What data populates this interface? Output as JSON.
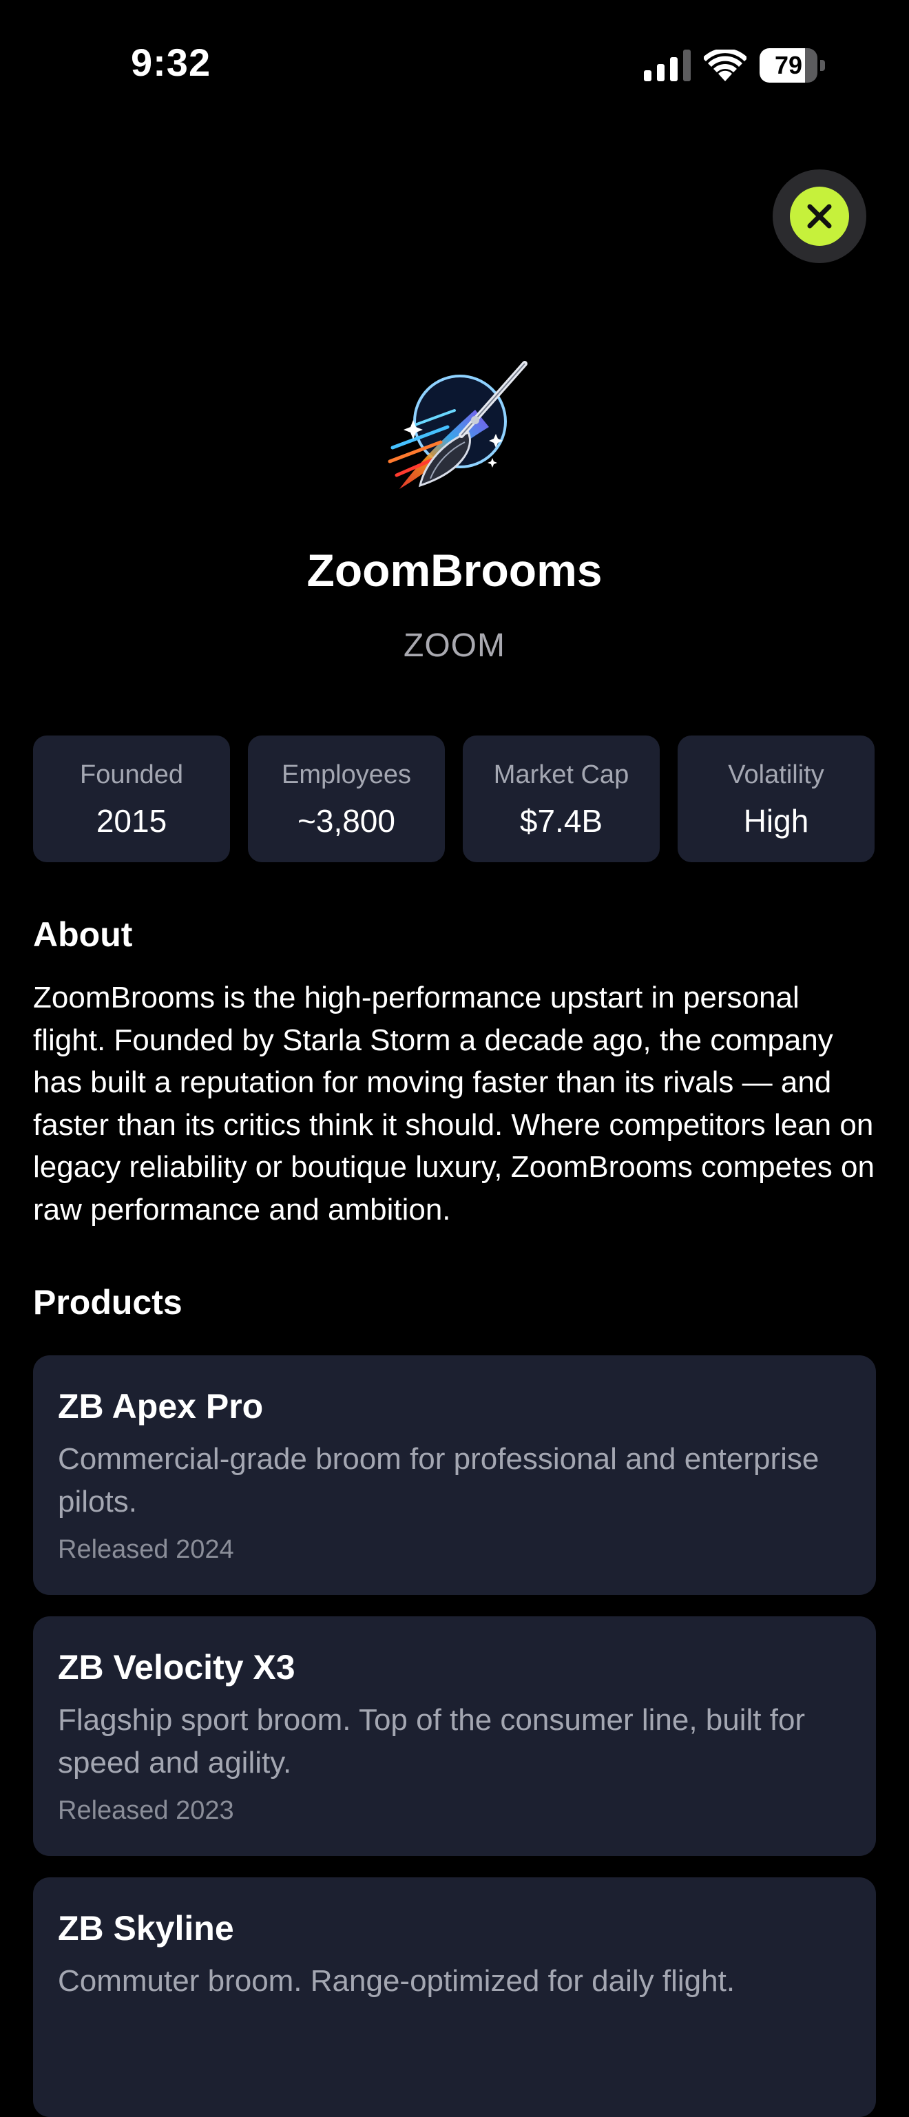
{
  "status_bar": {
    "time": "9:32",
    "battery_level": "79",
    "battery_fraction": 0.79,
    "signal_icon": "cellular-signal-icon",
    "wifi_icon": "wifi-icon"
  },
  "close_button": {
    "icon": "close-icon",
    "accent_color": "#c6f13b"
  },
  "company": {
    "logo": "broom-rocket-logo",
    "name": "ZoomBrooms",
    "ticker": "ZOOM"
  },
  "stats": [
    {
      "label": "Founded",
      "value": "2015"
    },
    {
      "label": "Employees",
      "value": "~3,800"
    },
    {
      "label": "Market Cap",
      "value": "$7.4B"
    },
    {
      "label": "Volatility",
      "value": "High"
    }
  ],
  "about": {
    "heading": "About",
    "text": "ZoomBrooms is the high-performance upstart in personal flight. Founded by Starla Storm a decade ago, the company has built a reputation for moving faster than its rivals — and faster than its critics think it should. Where competitors lean on legacy reliability or boutique luxury, ZoomBrooms competes on raw performance and ambition."
  },
  "products": {
    "heading": "Products",
    "items": [
      {
        "name": "ZB Apex Pro",
        "description": "Commercial-grade broom for professional and enterprise pilots.",
        "released": "Released 2024"
      },
      {
        "name": "ZB Velocity X3",
        "description": "Flagship sport broom. Top of the consumer line, built for speed and agility.",
        "released": "Released 2023"
      },
      {
        "name": "ZB Skyline",
        "description": "Commuter broom. Range-optimized for daily flight.",
        "released": ""
      }
    ]
  },
  "colors": {
    "background": "#000000",
    "card": "#1c2030",
    "muted_text": "#a4a7b2",
    "accent": "#c6f13b"
  }
}
